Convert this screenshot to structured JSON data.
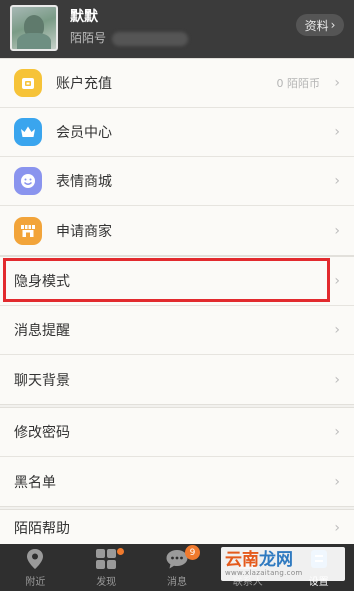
{
  "header": {
    "username": "默默",
    "momo_id_label": "陌陌号",
    "profile_button_label": "资料",
    "profile_button_chevron": "›"
  },
  "groups": [
    {
      "items": [
        {
          "label": "账户充值",
          "icon": "wallet-icon",
          "icon_color": "#f6c338",
          "extra": "0 陌陌币"
        },
        {
          "label": "会员中心",
          "icon": "crown-icon",
          "icon_color": "#3aa5ee"
        },
        {
          "label": "表情商城",
          "icon": "smiley-icon",
          "icon_color": "#8a94ee"
        },
        {
          "label": "申请商家",
          "icon": "shop-icon",
          "icon_color": "#f2a43a"
        }
      ]
    },
    {
      "items": [
        {
          "label": "隐身模式"
        },
        {
          "label": "消息提醒"
        },
        {
          "label": "聊天背景"
        }
      ]
    },
    {
      "items": [
        {
          "label": "修改密码"
        },
        {
          "label": "黑名单"
        }
      ]
    },
    {
      "items": [
        {
          "label": "陌陌帮助"
        }
      ]
    }
  ],
  "chevron": "›",
  "tabbar": {
    "tabs": [
      {
        "label": "附近",
        "icon": "location-pin-icon"
      },
      {
        "label": "发现",
        "icon": "grid-icon",
        "dot": true
      },
      {
        "label": "消息",
        "icon": "chat-bubble-icon",
        "badge": "9"
      },
      {
        "label": "联系人",
        "icon": "contacts-icon"
      },
      {
        "label": "设置",
        "icon": "settings-icon",
        "active": true
      }
    ]
  },
  "watermark": {
    "part1": "云南",
    "part2": "龙网",
    "sub": "www.xlazaitang.com"
  },
  "colors": {
    "header_bg": "#3b3b3b",
    "highlight_border": "#e22a2e",
    "tabbar_bg": "#2f2f2f",
    "badge": "#f07a2e"
  }
}
